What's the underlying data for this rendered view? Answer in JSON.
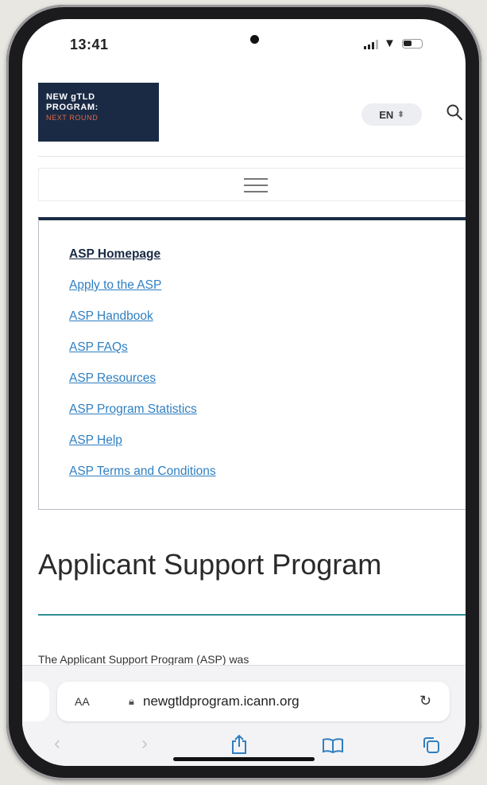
{
  "status_bar": {
    "time": "13:41"
  },
  "header": {
    "logo_line1": "NEW gTLD",
    "logo_line2": "PROGRAM:",
    "logo_line3": "NEXT ROUND",
    "language": "EN"
  },
  "nav": {
    "items": [
      {
        "label": "ASP Homepage",
        "active": true
      },
      {
        "label": "Apply to the ASP"
      },
      {
        "label": "ASP Handbook"
      },
      {
        "label": "ASP FAQs"
      },
      {
        "label": "ASP Resources"
      },
      {
        "label": "ASP Program Statistics"
      },
      {
        "label": "ASP Help"
      },
      {
        "label": "ASP Terms and Conditions"
      }
    ]
  },
  "main": {
    "title": "Applicant Support Program",
    "intro": "The Applicant Support Program (ASP) was"
  },
  "browser": {
    "text_size": "AA",
    "url": "newgtldprogram.icann.org"
  },
  "colors": {
    "brand_navy": "#1a2a44",
    "link": "#2f7fc1",
    "accent_teal": "#2f8f95",
    "logo_accent": "#e0694a"
  }
}
